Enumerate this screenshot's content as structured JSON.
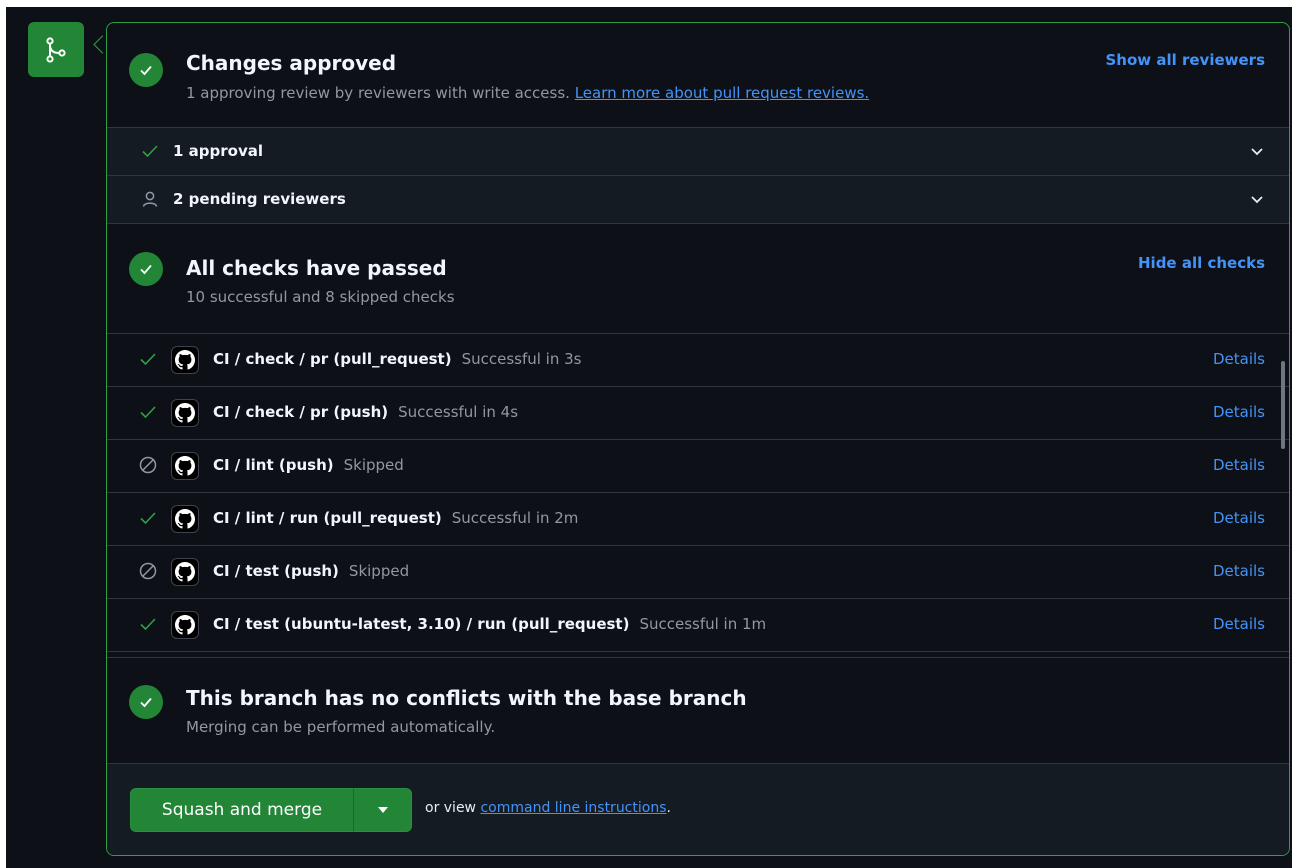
{
  "approval": {
    "title": "Changes approved",
    "subtitle": "1 approving review by reviewers with write access.",
    "learn_link": "Learn more about pull request reviews.",
    "show_all": "Show all reviewers",
    "approvals_row": "1 approval",
    "pending_row": "2 pending reviewers"
  },
  "checks": {
    "title": "All checks have passed",
    "subtitle": "10 successful and 8 skipped checks",
    "hide_all": "Hide all checks",
    "items": [
      {
        "name": "CI / check / pr (pull_request)",
        "status": "Successful in 3s",
        "state": "success",
        "details": "Details"
      },
      {
        "name": "CI / check / pr (push)",
        "status": "Successful in 4s",
        "state": "success",
        "details": "Details"
      },
      {
        "name": "CI / lint (push)",
        "status": "Skipped",
        "state": "skipped",
        "details": "Details"
      },
      {
        "name": "CI / lint / run (pull_request)",
        "status": "Successful in 2m",
        "state": "success",
        "details": "Details"
      },
      {
        "name": "CI / test (push)",
        "status": "Skipped",
        "state": "skipped",
        "details": "Details"
      },
      {
        "name": "CI / test (ubuntu-latest, 3.10) / run (pull_request)",
        "status": "Successful in 1m",
        "state": "success",
        "details": "Details"
      }
    ]
  },
  "conflicts": {
    "title": "This branch has no conflicts with the base branch",
    "subtitle": "Merging can be performed automatically."
  },
  "merge": {
    "button_label": "Squash and merge",
    "or_view": "or view",
    "cmd_link": "command line instructions",
    "period": "."
  },
  "colors": {
    "success": "#238636",
    "link": "#4493f8",
    "background": "#0d1117"
  }
}
